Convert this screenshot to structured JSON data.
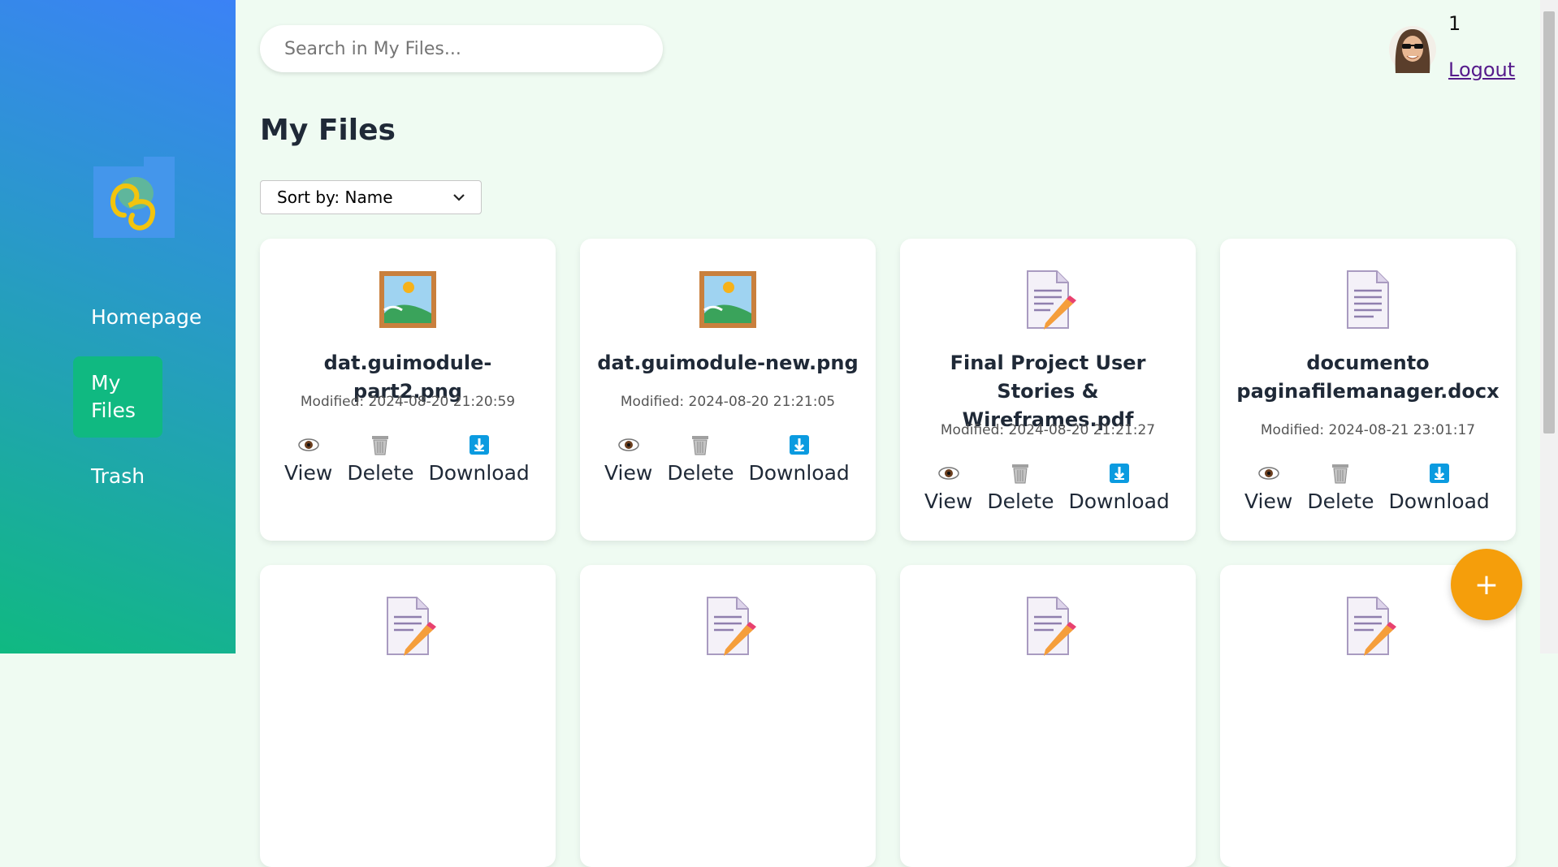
{
  "sidebar": {
    "items": [
      {
        "label": "Homepage"
      },
      {
        "label": "My\nFiles"
      },
      {
        "label": "Trash"
      }
    ]
  },
  "header": {
    "search_placeholder": "Search in My Files...",
    "user_id": "1",
    "logout_label": "Logout"
  },
  "main": {
    "title": "My Files",
    "sort_label": "Sort by: Name",
    "fab_label": "+",
    "files": [
      {
        "name": "dat.guimodule-part2.png",
        "modified": "Modified: 2024-08-20 21:20:59",
        "type": "image"
      },
      {
        "name": "dat.guimodule-new.png",
        "modified": "Modified: 2024-08-20 21:21:05",
        "type": "image"
      },
      {
        "name": "Final Project User Stories & Wireframes.pdf",
        "modified": "Modified: 2024-08-20 21:21:27",
        "type": "pdf"
      },
      {
        "name": "documento paginafilemanager.docx",
        "modified": "Modified: 2024-08-21 23:01:17",
        "type": "doc"
      }
    ],
    "actions": {
      "view": "View",
      "delete": "Delete",
      "download": "Download"
    }
  },
  "colors": {
    "sidebar_top": "#3b82f6",
    "sidebar_bottom": "#10b981",
    "active_nav": "#10b981",
    "fab": "#f59e0b",
    "background": "#effbf2"
  }
}
